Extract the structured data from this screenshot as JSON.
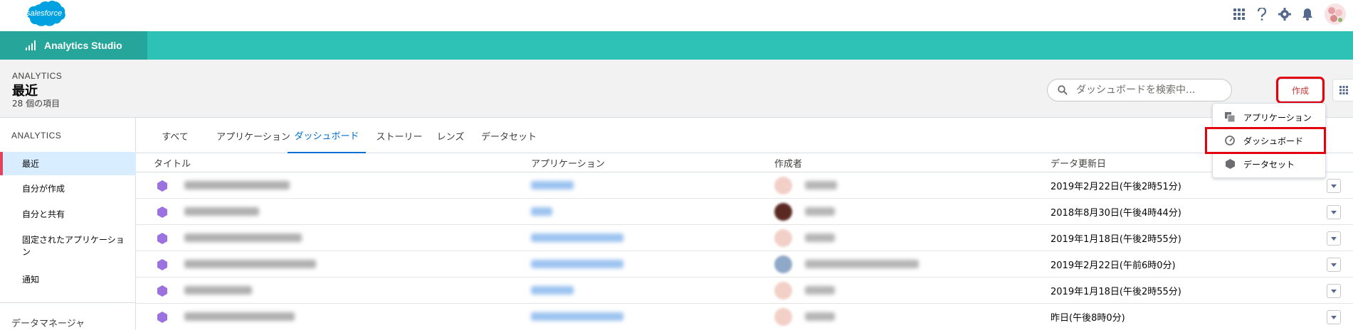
{
  "header": {
    "logo_text": "salesforce",
    "icons": [
      "app-launcher-icon",
      "help-icon",
      "setup-gear-icon",
      "notifications-bell-icon",
      "user-avatar"
    ]
  },
  "app_nav": {
    "tab_label": "Analytics Studio"
  },
  "page_header": {
    "eyebrow": "ANALYTICS",
    "title": "最近",
    "subtitle": "28 個の項目",
    "search_placeholder": "ダッシュボードを検索中...",
    "create_label": "作成"
  },
  "create_menu": {
    "items": [
      {
        "label": "アプリケーション",
        "icon": "app-icon"
      },
      {
        "label": "ダッシュボード",
        "icon": "dashboard-icon"
      },
      {
        "label": "データセット",
        "icon": "dataset-icon"
      }
    ]
  },
  "sidebar": {
    "heading": "ANALYTICS",
    "items": [
      {
        "label": "最近"
      },
      {
        "label": "自分が作成"
      },
      {
        "label": "自分と共有"
      },
      {
        "label": "固定されたアプリケーション"
      },
      {
        "label": "通知"
      }
    ],
    "bottom_label": "データマネージャ"
  },
  "tabs": [
    {
      "label": "すべて"
    },
    {
      "label": "アプリケーション"
    },
    {
      "label": "ダッシュボード"
    },
    {
      "label": "ストーリー"
    },
    {
      "label": "レンズ"
    },
    {
      "label": "データセット"
    }
  ],
  "table": {
    "columns": [
      "タイトル",
      "アプリケーション",
      "作成者",
      "データ更新日"
    ],
    "rows": [
      {
        "date": "2019年2月22日(午後2時51分)"
      },
      {
        "date": "2018年8月30日(午後4時44分)"
      },
      {
        "date": "2019年1月18日(午後2時55分)"
      },
      {
        "date": "2019年2月22日(午前6時0分)"
      },
      {
        "date": "2019年1月18日(午後2時55分)"
      },
      {
        "date": "昨日(午後8時0分)"
      }
    ]
  },
  "colors": {
    "app_nav": "#2ec1b6",
    "app_tab": "#26a69b",
    "active_tab": "#0070d2",
    "highlight_outline": "#e3000f",
    "dashboard_icon": "#9b72e0"
  }
}
